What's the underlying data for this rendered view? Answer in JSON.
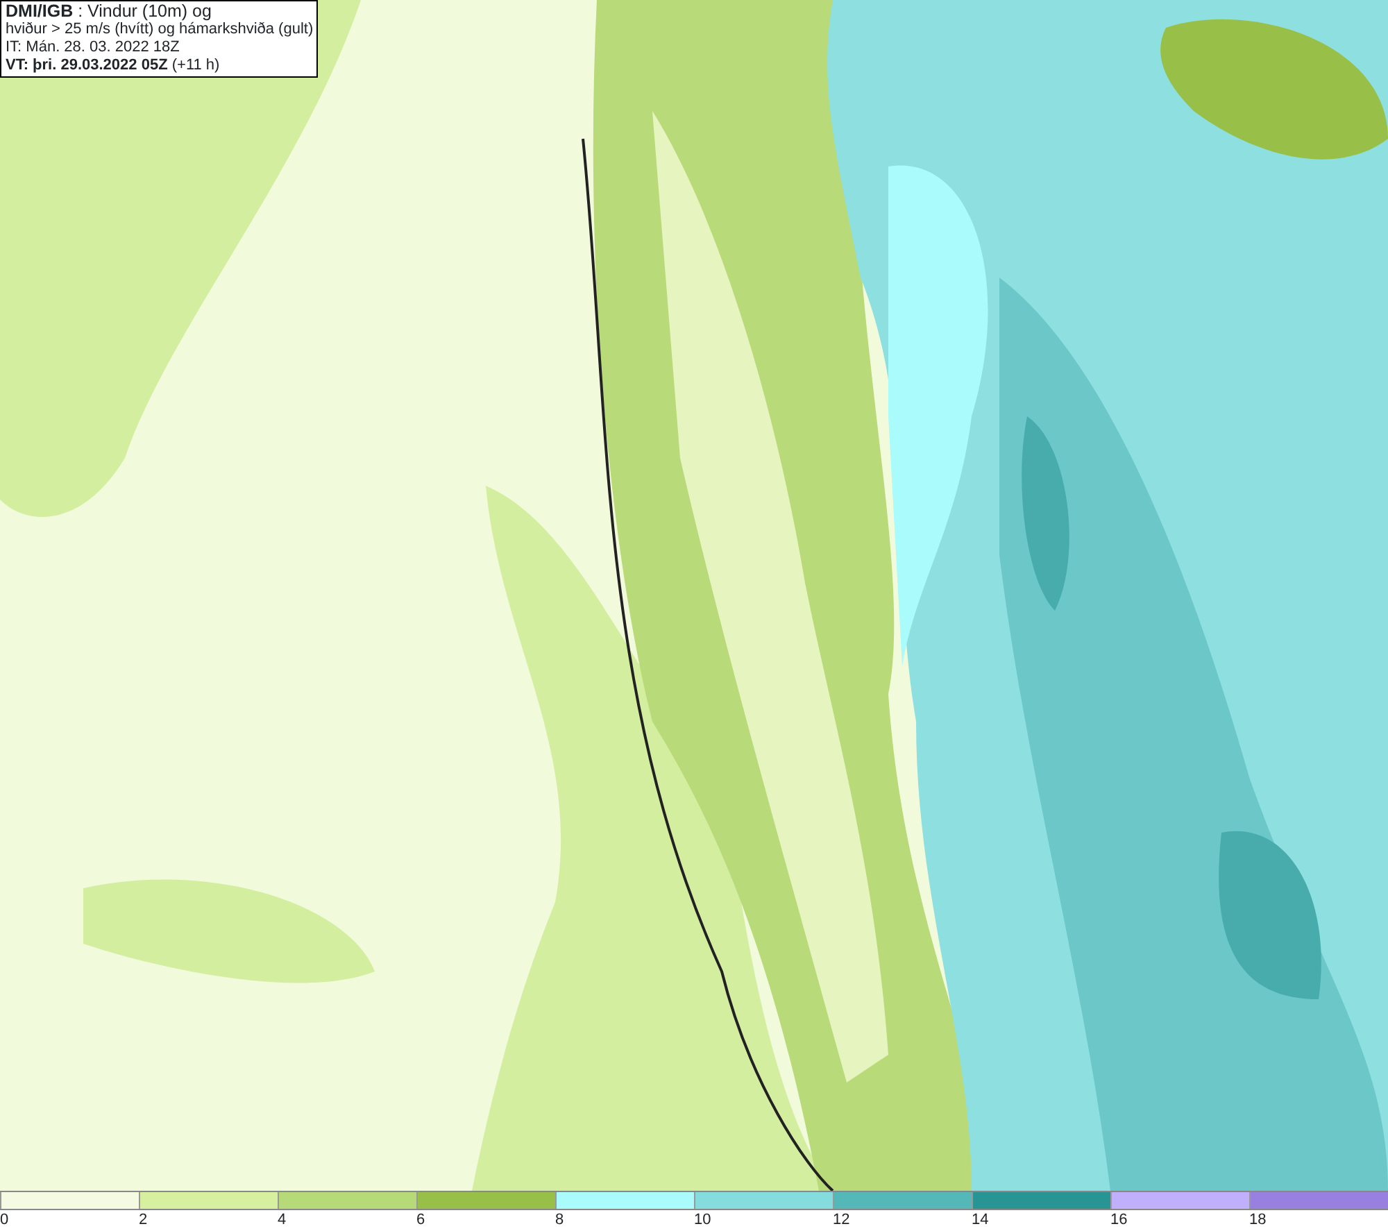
{
  "title_box": {
    "lines": [
      "**DMI/IGB** : Vindur (10m) og",
      "hviður > 25 m/s (hvítt) og hámarkshviða (gult)",
      "IT: Mán. 28. 03. 2022 18Z",
      "**VT: þri. 29.03.2022 05Z** (+11 h)"
    ]
  },
  "color_scale": {
    "bins": [
      {
        "label": "0",
        "color": "#f4fbe2"
      },
      {
        "label": "2",
        "color": "#d7f0a0"
      },
      {
        "label": "4",
        "color": "#b6da78"
      },
      {
        "label": "6",
        "color": "#98c048"
      },
      {
        "label": "8",
        "color": "#aafcfc"
      },
      {
        "label": "10",
        "color": "#84dcdc"
      },
      {
        "label": "12",
        "color": "#54b8b8"
      },
      {
        "label": "14",
        "color": "#289494"
      },
      {
        "label": "16",
        "color": "#c0b0fc"
      },
      {
        "label": "18",
        "color": "#9880e0"
      }
    ]
  }
}
